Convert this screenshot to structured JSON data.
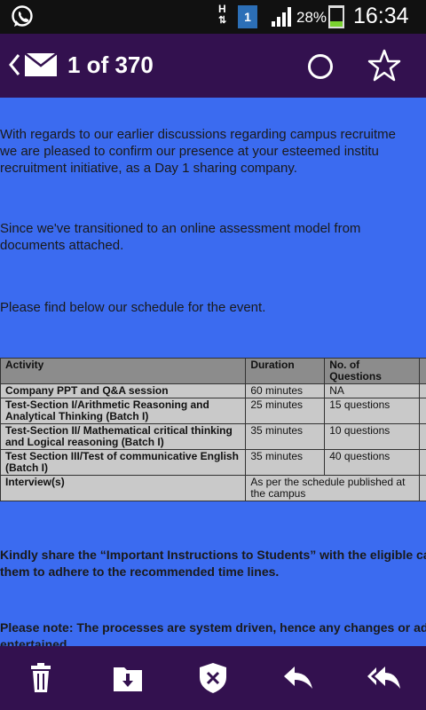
{
  "status_bar": {
    "h_indicator": "H",
    "notification_count": "1",
    "battery_percent": "28%",
    "time": "16:34"
  },
  "header": {
    "counter": "1 of 370"
  },
  "email": {
    "para1": [
      "With regards to our earlier discussions regarding campus recruitme",
      "we are pleased to confirm our presence at your esteemed institu",
      "recruitment initiative, as a Day 1 sharing company."
    ],
    "para2": [
      "Since we've transitioned to an online assessment model from",
      "documents attached."
    ],
    "para3": "Please find below our schedule for the event.",
    "table": {
      "headers": [
        "Activity",
        "Duration",
        "No. of Questions",
        ""
      ],
      "rows": [
        [
          "Company PPT and Q&A session",
          "60 minutes",
          "NA",
          ""
        ],
        [
          "Test-Section I/Arithmetic Reasoning and Analytical Thinking (Batch I)",
          "25 minutes",
          "15 questions",
          ""
        ],
        [
          "Test-Section II/ Mathematical critical thinking and Logical reasoning (Batch I)",
          "35 minutes",
          "10 questions",
          ""
        ],
        [
          "Test Section III/Test of communicative English (Batch I)",
          "35 minutes",
          "40 questions",
          ""
        ]
      ],
      "interview_activity": "Interview(s)",
      "interview_duration": "As per the schedule published at the campus"
    },
    "para4": [
      "Kindly share the “Important Instructions to Students” with the eligible ca",
      "them to adhere to the recommended time lines."
    ],
    "para5": [
      "Please note: The processes are system driven, hence any changes  or ad",
      "entertained."
    ]
  },
  "colors": {
    "header_bg": "#33114f",
    "content_bg": "#3b6bf0",
    "table_header_bg": "#8c8c8c",
    "table_cell_bg": "#c9c9c9"
  }
}
